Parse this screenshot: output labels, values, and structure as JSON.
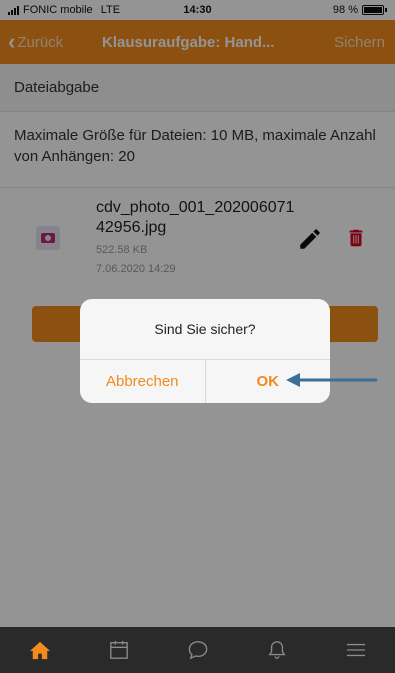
{
  "status_bar": {
    "carrier": "FONIC mobile",
    "network": "LTE",
    "time": "14:30",
    "battery": "98 %"
  },
  "header": {
    "back_label": "Zurück",
    "title": "Klausuraufgabe: Hand...",
    "save_label": "Sichern"
  },
  "section": {
    "title": "Dateiabgabe"
  },
  "info_text": "Maximale Größe für Dateien: 10 MB, maximale Anzahl von Anhängen: 20",
  "file": {
    "name": "cdv_photo_001_20200607142956.jpg",
    "size": "522.58 KB",
    "date": "7.06.2020 14:29",
    "icon": "image-file-icon"
  },
  "dialog": {
    "message": "Sind Sie sicher?",
    "cancel_label": "Abbrechen",
    "ok_label": "OK"
  },
  "tabbar": {
    "items": [
      "home-icon",
      "calendar-icon",
      "chat-icon",
      "bell-icon",
      "menu-icon"
    ],
    "active": "home-icon"
  },
  "colors": {
    "accent": "#f28a1d",
    "tabbar_bg": "#2a2a2a",
    "delete_red": "#d0021b",
    "arrow_blue": "#3d6f96"
  }
}
